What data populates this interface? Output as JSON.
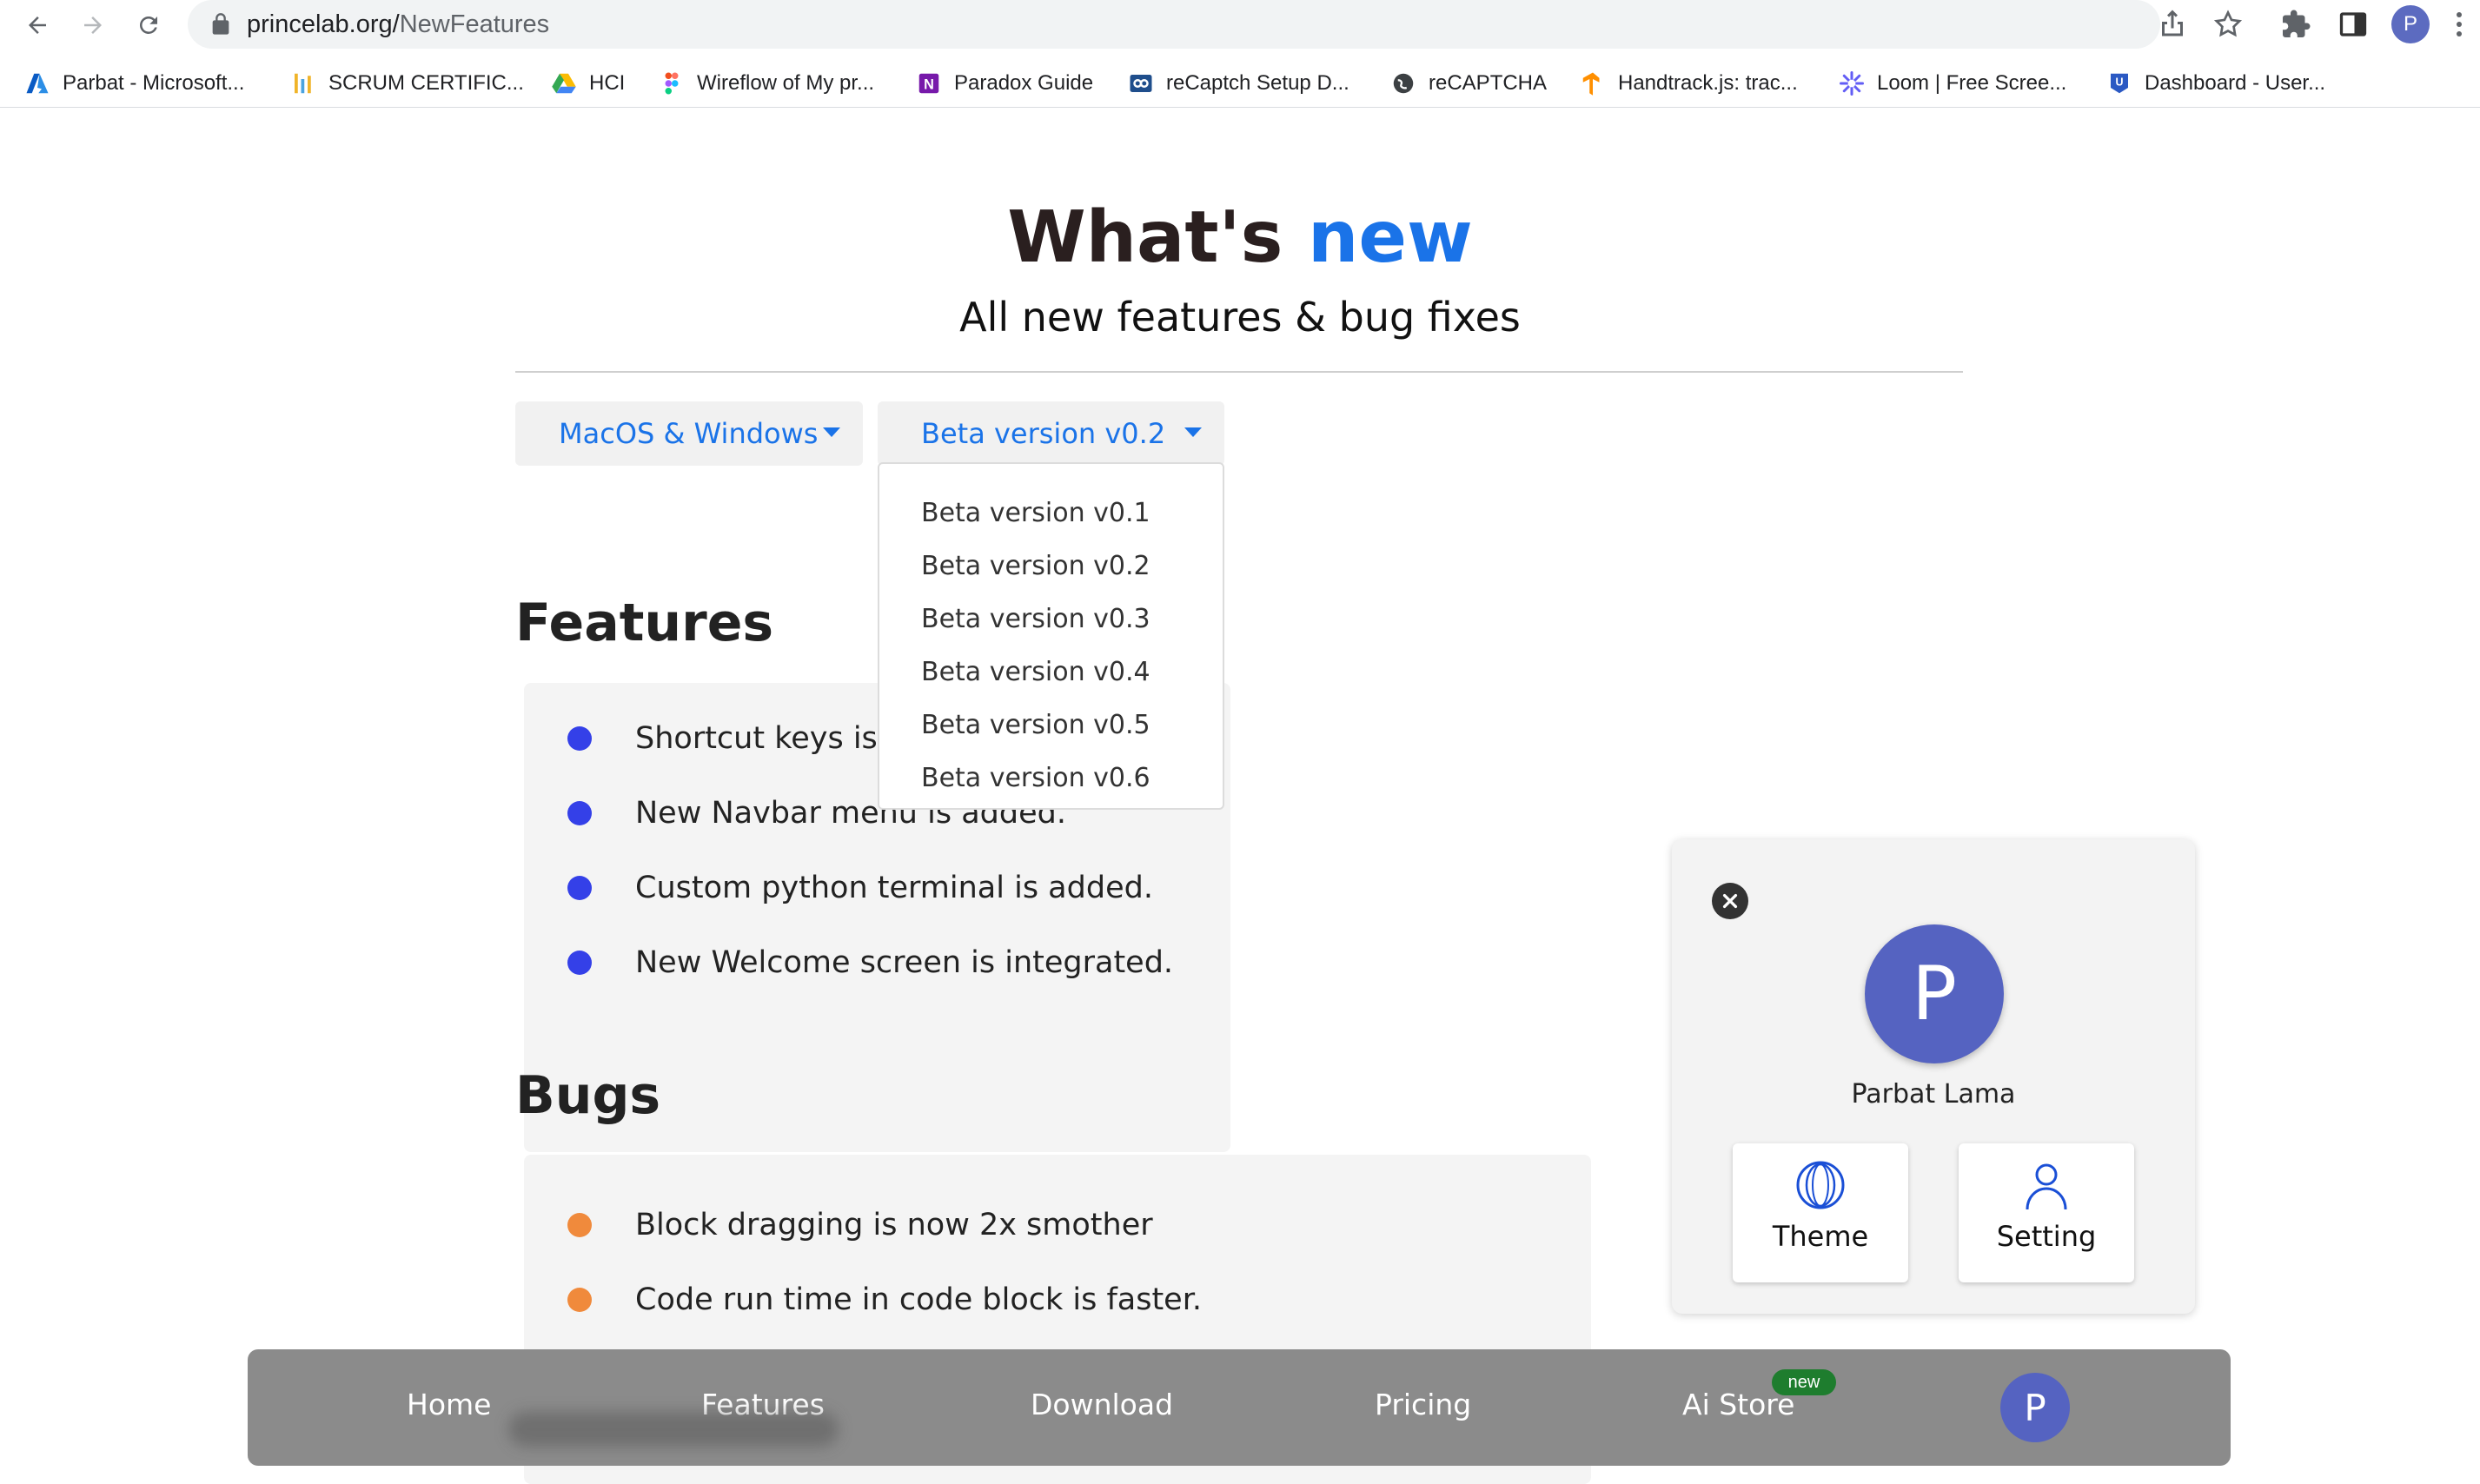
{
  "browser": {
    "url_host": "princelab.org/",
    "url_path": "NewFeatures",
    "profile_initial": "P",
    "bookmarks": [
      {
        "label": "Parbat - Microsoft...",
        "icon": "azure-icon"
      },
      {
        "label": "SCRUM CERTIFIC...",
        "icon": "scrum-icon"
      },
      {
        "label": "HCI",
        "icon": "google-drive-icon"
      },
      {
        "label": "Wireflow of My pr...",
        "icon": "figma-icon"
      },
      {
        "label": "Paradox Guide",
        "icon": "onenote-icon"
      },
      {
        "label": "reCaptch Setup D...",
        "icon": "recaptcha-setup-icon"
      },
      {
        "label": "reCAPTCHA",
        "icon": "globe-icon"
      },
      {
        "label": "Handtrack.js: trac...",
        "icon": "tensorflow-icon"
      },
      {
        "label": "Loom | Free Scree...",
        "icon": "loom-icon"
      },
      {
        "label": "Dashboard - User...",
        "icon": "dashboard-icon"
      }
    ]
  },
  "hero": {
    "title_main": "What's",
    "title_accent": "new",
    "subtitle": "All new features & bug fixes"
  },
  "filters": {
    "platform": "MacOS & Windows",
    "version": "Beta version v0.2",
    "version_options": [
      "Beta version v0.1",
      "Beta version v0.2",
      "Beta version v0.3",
      "Beta version v0.4",
      "Beta version v0.5",
      "Beta version v0.6"
    ]
  },
  "features": {
    "title": "Features",
    "items": [
      "Shortcut keys is a",
      "New Navbar menu is added.",
      "Custom python terminal is added.",
      "New Welcome screen is integrated."
    ],
    "dot_color": "#3440e8"
  },
  "bugs": {
    "title": "Bugs",
    "items": [
      "Block dragging is now 2x smother",
      "Code run time in code block is faster."
    ],
    "dot_color": "#f08a3c"
  },
  "profile": {
    "initial": "P",
    "name": "Parbat Lama",
    "theme_label": "Theme",
    "setting_label": "Setting"
  },
  "bottom_nav": {
    "items": [
      "Home",
      "Features",
      "Download",
      "Pricing",
      "Ai Store"
    ],
    "badge": "new",
    "avatar_initial": "P"
  },
  "colors": {
    "accent": "#1a73e8",
    "avatar": "#5563c1",
    "nav_bg": "#8b8b8b"
  }
}
